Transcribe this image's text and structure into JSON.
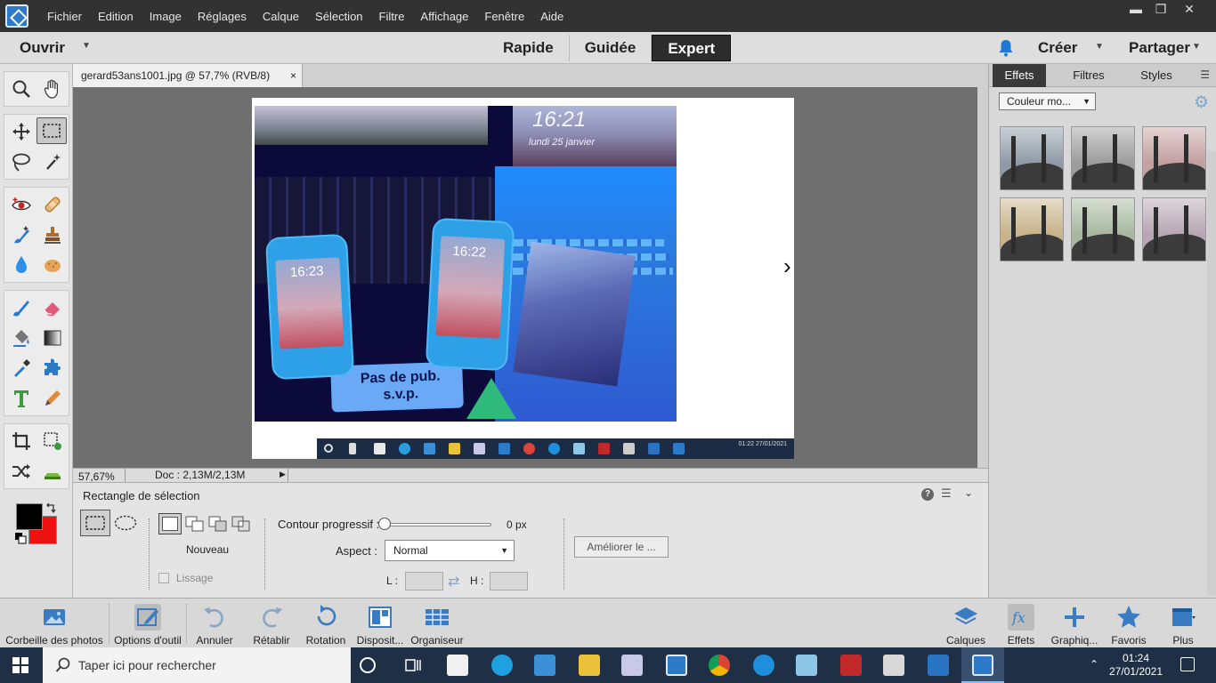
{
  "menubar": {
    "items": [
      "Fichier",
      "Edition",
      "Image",
      "Réglages",
      "Calque",
      "Sélection",
      "Filtre",
      "Affichage",
      "Fenêtre",
      "Aide"
    ],
    "minimize": "▬",
    "restore": "❐",
    "close": "✕"
  },
  "modebar": {
    "open_label": "Ouvrir",
    "modes": [
      "Rapide",
      "Guidée",
      "Expert"
    ],
    "active_mode": "Expert",
    "create_label": "Créer",
    "share_label": "Partager"
  },
  "document": {
    "tab_title": "gerard53ans1001.jpg @ 57,7% (RVB/8)",
    "tab_close": "×",
    "zoom": "57,67%",
    "doc_size": "Doc : 2,13M/2,13M",
    "photo_time": "16:21",
    "photo_date": "lundi 25 janvier",
    "phone1_time": "16:23",
    "phone2_time": "16:22",
    "sign_text": "Pas de pub. s.v.p.",
    "photo_taskbar_clock": "01:22 27/01/2021"
  },
  "options": {
    "title": "Rectangle de sélection",
    "new_label": "Nouveau",
    "smooth_label": "Lissage",
    "feather_label": "Contour progressif :",
    "feather_value": "0 px",
    "feather_fraction": 0,
    "aspect_label": "Aspect :",
    "aspect_value": "Normal",
    "width_label": "L :",
    "height_label": "H :",
    "refine_label": "Améliorer le ..."
  },
  "right_panel": {
    "tabs": [
      "Effets",
      "Filtres",
      "Styles"
    ],
    "active_tab": "Effets",
    "category": "Couleur mo...",
    "thumb_tints": [
      "#8f9aa8",
      "#9c9c9c",
      "#c4a0a0",
      "#c8b48a",
      "#a7b89f",
      "#b8a6b4"
    ]
  },
  "bottombar": {
    "left": [
      "Corbeille des photos",
      "Options d'outil",
      "Annuler",
      "Rétablir",
      "Rotation",
      "Disposit...",
      "Organiseur"
    ],
    "right": [
      "Calques",
      "Effets",
      "Graphiq...",
      "Favoris",
      "Plus"
    ]
  },
  "taskbar": {
    "search_placeholder": "Taper ici pour rechercher",
    "time": "01:24",
    "date": "27/01/2021"
  },
  "colors": {
    "accent": "#2c7ac8",
    "foreground_swatch": "#000000",
    "background_swatch": "#ee1111"
  }
}
